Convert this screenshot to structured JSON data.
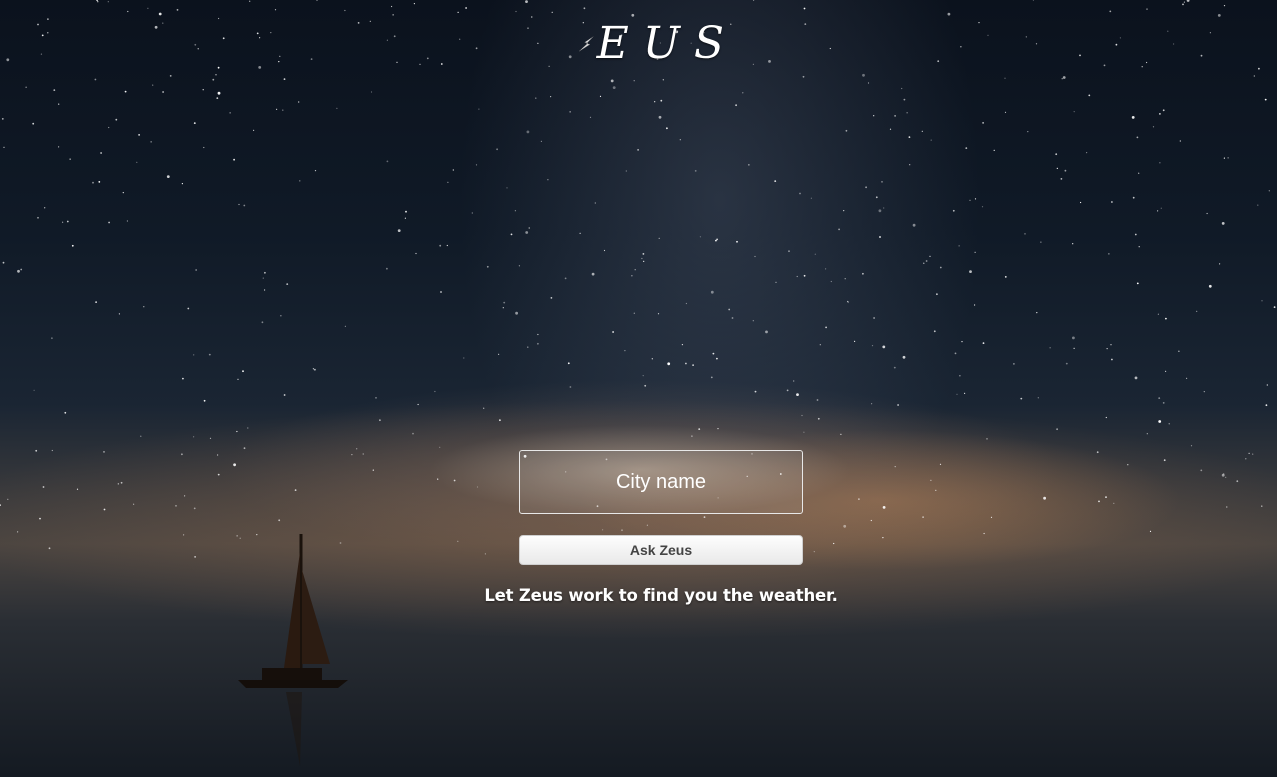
{
  "app": {
    "logo_text": "EUS",
    "logo_icon": "lightning-bolt-icon"
  },
  "search": {
    "placeholder": "City name",
    "value": ""
  },
  "actions": {
    "ask_label": "Ask Zeus"
  },
  "main": {
    "tagline": "Let Zeus work to find you the weather."
  },
  "colors": {
    "text": "#ffffff",
    "button_bg": "#f0f0f0",
    "button_text": "#444444",
    "sky_top": "#0b121d",
    "horizon_glow": "#a07a58"
  }
}
